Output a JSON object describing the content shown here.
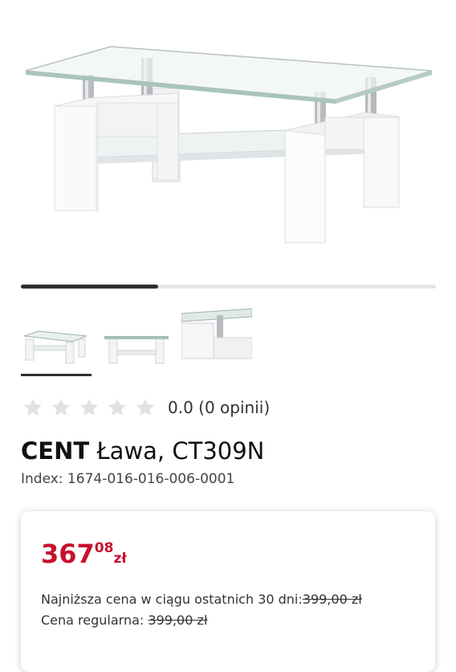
{
  "gallery": {
    "progress": 0.33,
    "thumbnails": [
      {
        "name": "thumbnail-front",
        "selected": true
      },
      {
        "name": "thumbnail-side",
        "selected": false
      },
      {
        "name": "thumbnail-detail",
        "selected": false
      }
    ]
  },
  "rating": {
    "stars_filled": 0,
    "stars_total": 5,
    "text": "0.0 (0 opinii)"
  },
  "product": {
    "brand": "CENT",
    "name": "Ława, CT309N",
    "index": "Index: 1674-016-016-006-0001"
  },
  "price": {
    "integer": "367",
    "decimal": "08",
    "currency": "zł",
    "lowest_label": "Najniższa cena w ciągu ostatnich 30 dni:",
    "lowest_value": "399,00 zł",
    "regular_label": "Cena regularna: ",
    "regular_value": "399,00 zł"
  },
  "colors": {
    "price": "#c8102e",
    "progress": "#2f2f2f",
    "star_empty": "#e2e2e2"
  }
}
